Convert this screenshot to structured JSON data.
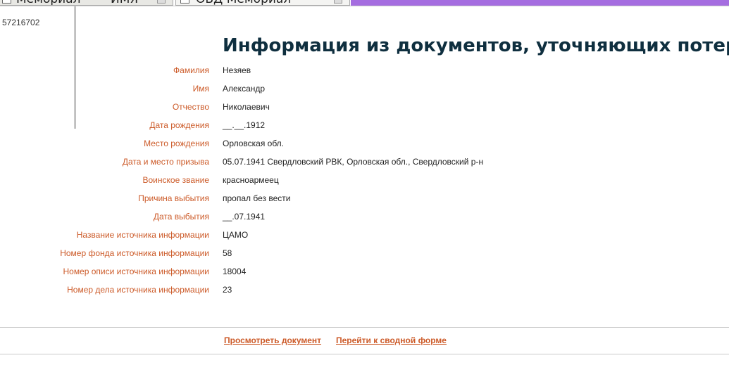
{
  "tabs": [
    {
      "label": "Мемориал",
      "label2": "ИМЯ"
    },
    {
      "label": "ОБД Мемориал"
    }
  ],
  "colors": {
    "label": "#cc5a28",
    "value": "#222222",
    "title": "#0f2f3f",
    "tab_accent": "#a56de0",
    "link": "#cc5a28"
  },
  "record_id": "57216702",
  "title": "Информация из документов, уточняющих потери",
  "fields": [
    {
      "label": "Фамилия",
      "value": "Незяев"
    },
    {
      "label": "Имя",
      "value": "Александр"
    },
    {
      "label": "Отчество",
      "value": "Николаевич"
    },
    {
      "label": "Дата рождения",
      "value": "__.__.1912"
    },
    {
      "label": "Место рождения",
      "value": "Орловская обл."
    },
    {
      "label": "Дата и место призыва",
      "value": "05.07.1941 Свердловский РВК, Орловская обл., Свердловский р-н"
    },
    {
      "label": "Воинское звание",
      "value": "красноармеец"
    },
    {
      "label": "Причина выбытия",
      "value": "пропал без вести"
    },
    {
      "label": "Дата выбытия",
      "value": "__.07.1941"
    },
    {
      "label": "Название источника информации",
      "value": "ЦАМО"
    },
    {
      "label": "Номер фонда источника информации",
      "value": "58"
    },
    {
      "label": "Номер описи источника информации",
      "value": "18004"
    },
    {
      "label": "Номер дела источника информации",
      "value": "23"
    }
  ],
  "actions": {
    "view_document": "Просмотреть документ",
    "go_to_summary": "Перейти к сводной форме"
  }
}
